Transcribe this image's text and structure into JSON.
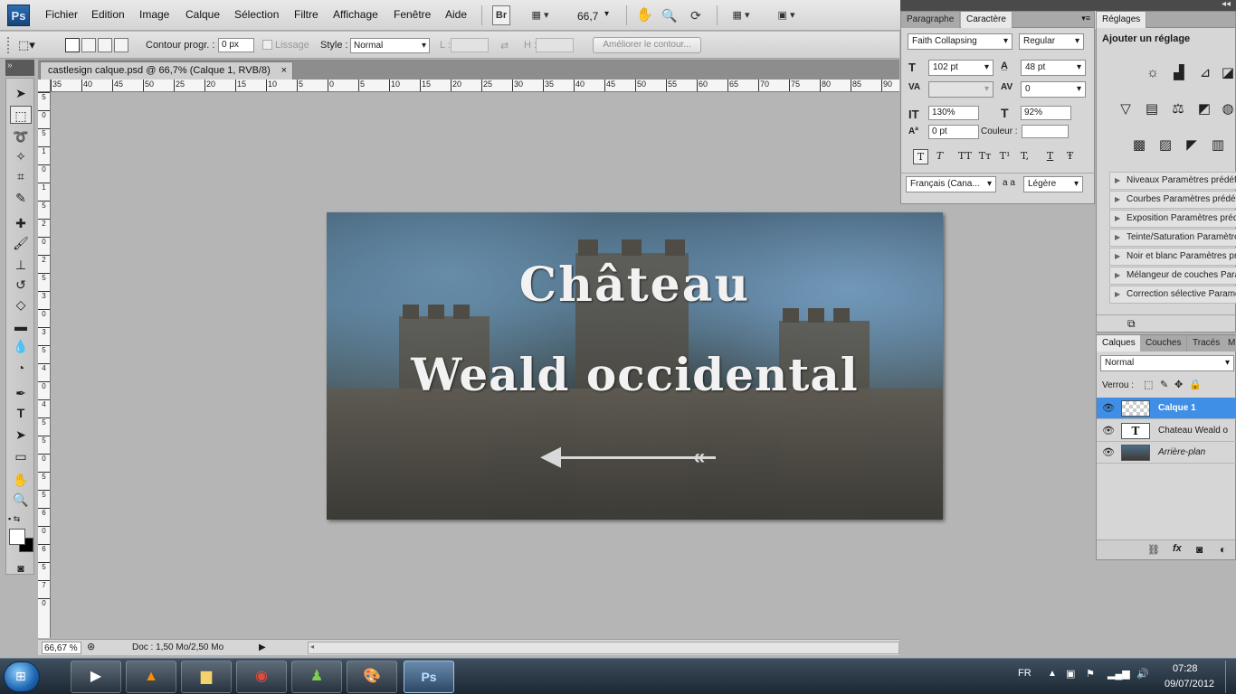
{
  "app": {
    "logo": "Ps"
  },
  "menubar": {
    "items": [
      "Fichier",
      "Edition",
      "Image",
      "Calque",
      "Sélection",
      "Filtre",
      "Affichage",
      "Fenêtre",
      "Aide"
    ],
    "bridge": "Br",
    "zoom": "66,7"
  },
  "options": {
    "contour_label": "Contour progr. :",
    "contour_value": "0 px",
    "lissage": "Lissage",
    "style_label": "Style :",
    "style_value": "Normal",
    "l_label": "L :",
    "h_label": "H :",
    "ameliorer": "Améliorer le contour..."
  },
  "document": {
    "tab_title": "castlesign calque.psd @ 66,7% (Calque 1, RVB/8)",
    "close": "×",
    "art_line1": "Château",
    "art_line2": "Weald occidental"
  },
  "rulers": {
    "top": [
      "35",
      "40",
      "45",
      "50",
      "25",
      "20",
      "15",
      "10",
      "5",
      "0",
      "5",
      "10",
      "15",
      "20",
      "25",
      "30",
      "35",
      "40",
      "45",
      "50",
      "55",
      "60",
      "65",
      "70",
      "75",
      "80",
      "85",
      "90"
    ],
    "left": [
      "5",
      "0",
      "5",
      "1",
      "0",
      "1",
      "5",
      "2",
      "0",
      "2",
      "5",
      "3",
      "0",
      "3",
      "5",
      "4",
      "0",
      "4",
      "5",
      "5",
      "0",
      "5",
      "5",
      "6",
      "0",
      "6",
      "5",
      "7",
      "0"
    ]
  },
  "status": {
    "zoom": "66,67 %",
    "doc": "Doc : 1,50 Mo/2,50 Mo"
  },
  "character": {
    "tab_paragraph": "Paragraphe",
    "tab_character": "Caractère",
    "font": "Faith Collapsing",
    "style": "Regular",
    "size": "102 pt",
    "leading": "48 pt",
    "tracking": "0",
    "vscale": "130%",
    "hscale": "92%",
    "baseline": "0 pt",
    "color_label": "Couleur :",
    "language": "Français (Cana...",
    "aa_label": "a a",
    "antialias": "Légère",
    "formats": [
      "T",
      "T",
      "TT",
      "Tт",
      "T¹",
      "T,",
      "T",
      "Ŧ"
    ]
  },
  "adjustments": {
    "tab": "Réglages",
    "title": "Ajouter un réglage",
    "presets": [
      "Niveaux Paramètres prédéfinis",
      "Courbes Paramètres prédéfinis",
      "Exposition Paramètres prédéfinis",
      "Teinte/Saturation Paramètres",
      "Noir et blanc Paramètres prédéfinis",
      "Mélangeur de couches Paramètres",
      "Correction sélective Paramètres"
    ]
  },
  "layers": {
    "tabs": [
      "Calques",
      "Couches",
      "Tracés",
      "M"
    ],
    "blend": "Normal",
    "lock_label": "Verrou :",
    "items": [
      {
        "name": "Calque 1",
        "selected": true
      },
      {
        "name": "Chateau     Weald  o",
        "selected": false
      },
      {
        "name": "Arrière-plan",
        "selected": false
      }
    ],
    "type_glyph": "T"
  },
  "taskbar": {
    "lang": "FR",
    "time": "07:28",
    "date": "09/07/2012"
  },
  "colors": {
    "selection": "#3f8fe6",
    "taskbar": "#1c2833",
    "accent_ps": "#2f6fb0"
  }
}
